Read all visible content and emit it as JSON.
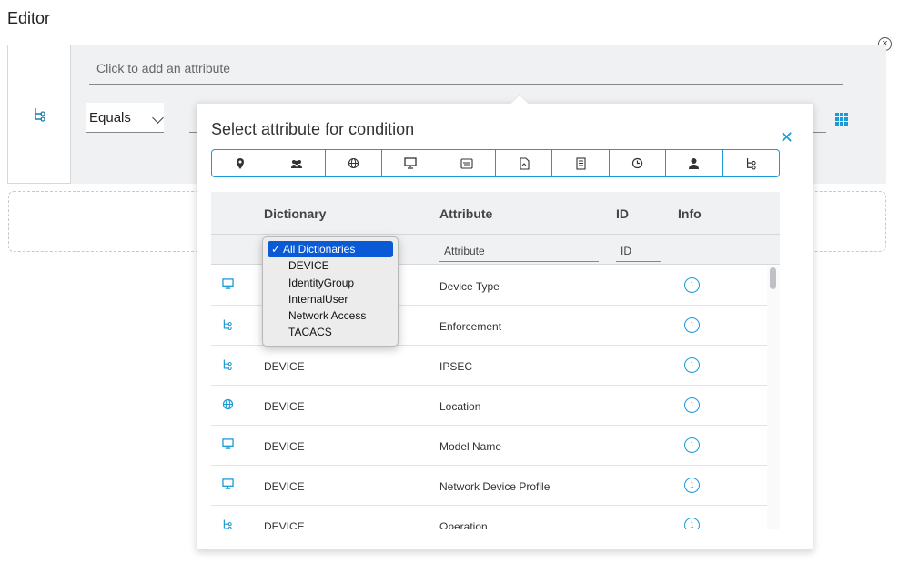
{
  "editor": {
    "title": "Editor"
  },
  "condition": {
    "attribute_placeholder": "Click to add an attribute",
    "operator": "Equals"
  },
  "popup": {
    "title": "Select attribute for condition",
    "icon_bar": [
      "location-pin-icon",
      "users-icon",
      "globe-icon",
      "monitor-icon",
      "certificate-icon",
      "file-icon",
      "building-icon",
      "clock-icon",
      "person-icon",
      "tree-icon"
    ],
    "columns": {
      "dictionary": "Dictionary",
      "attribute": "Attribute",
      "id": "ID",
      "info": "Info"
    },
    "filters": {
      "attribute": "Attribute",
      "id": "ID"
    },
    "rows": [
      {
        "icon": "monitor-icon",
        "dictionary": "",
        "attribute": "Device Type"
      },
      {
        "icon": "tree-icon",
        "dictionary": "",
        "attribute": "Enforcement"
      },
      {
        "icon": "tree-icon",
        "dictionary": "DEVICE",
        "attribute": "IPSEC"
      },
      {
        "icon": "globe-icon",
        "dictionary": "DEVICE",
        "attribute": "Location"
      },
      {
        "icon": "monitor-icon",
        "dictionary": "DEVICE",
        "attribute": "Model Name"
      },
      {
        "icon": "monitor-icon",
        "dictionary": "DEVICE",
        "attribute": "Network Device Profile"
      },
      {
        "icon": "tree-icon",
        "dictionary": "DEVICE",
        "attribute": "Operation"
      }
    ]
  },
  "dictionary_dropdown": {
    "selected": "All Dictionaries",
    "check": "✓",
    "options": [
      "DEVICE",
      "IdentityGroup",
      "InternalUser",
      "Network Access",
      "TACACS"
    ]
  },
  "colors": {
    "accent": "#1a9ad6",
    "selected": "#0a5ad6"
  }
}
